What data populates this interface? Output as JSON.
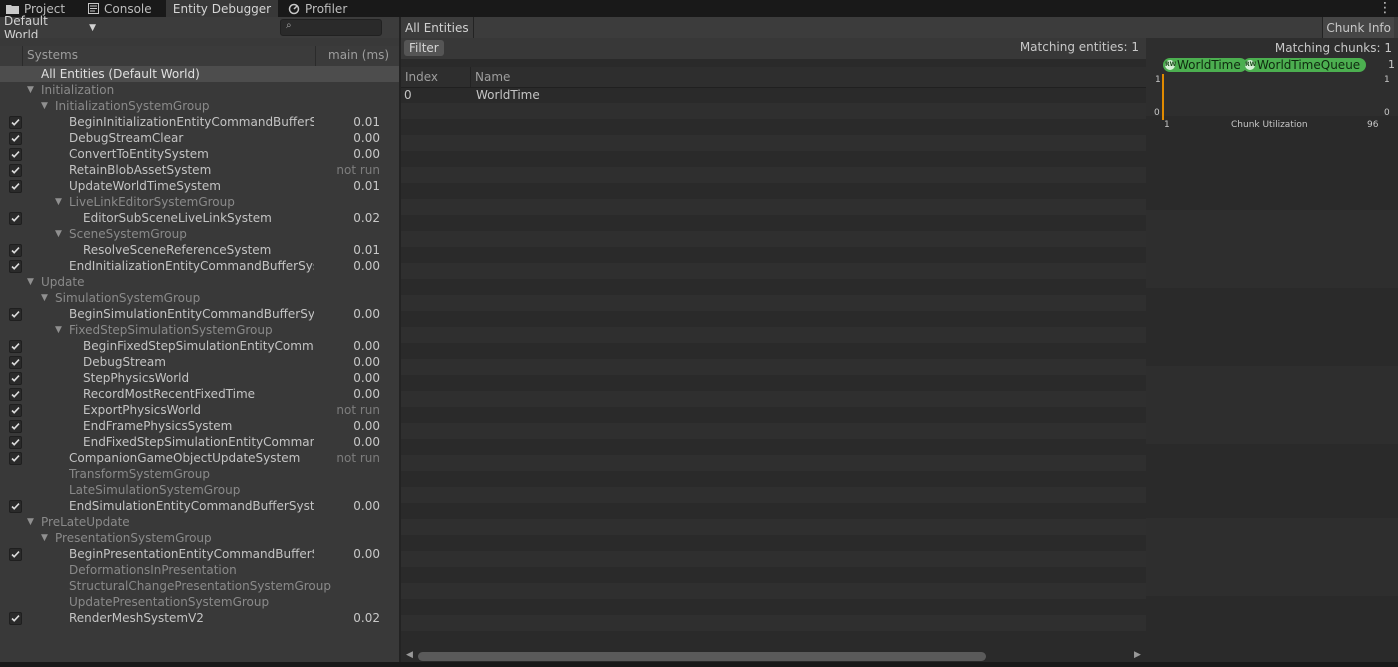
{
  "tabs": [
    {
      "label": "Project",
      "icon": "folder-icon"
    },
    {
      "label": "Console",
      "icon": "console-icon"
    },
    {
      "label": "Entity Debugger",
      "icon": ""
    },
    {
      "label": "Profiler",
      "icon": "profiler-icon"
    }
  ],
  "toolbar": {
    "world": "Default World",
    "search_placeholder": "",
    "all_entities": "All Entities",
    "chunk_info": "Chunk Info"
  },
  "systems": {
    "header": {
      "name": "Systems",
      "time": "main (ms)"
    },
    "rows": [
      {
        "label": "All Entities (Default World)",
        "selected": true
      },
      {
        "label": "Initialization",
        "group": true
      },
      {
        "label": "InitializationSystemGroup",
        "group": true
      },
      {
        "label": "BeginInitializationEntityCommandBufferSystem",
        "value": "0.01",
        "checked": true
      },
      {
        "label": "DebugStreamClear",
        "value": "0.00",
        "checked": true
      },
      {
        "label": "ConvertToEntitySystem",
        "value": "0.00",
        "checked": true
      },
      {
        "label": "RetainBlobAssetSystem",
        "value": "not run",
        "checked": true
      },
      {
        "label": "UpdateWorldTimeSystem",
        "value": "0.01",
        "checked": true
      },
      {
        "label": "LiveLinkEditorSystemGroup",
        "group": true
      },
      {
        "label": "EditorSubSceneLiveLinkSystem",
        "value": "0.02",
        "checked": true
      },
      {
        "label": "SceneSystemGroup",
        "group": true
      },
      {
        "label": "ResolveSceneReferenceSystem",
        "value": "0.01",
        "checked": true
      },
      {
        "label": "EndInitializationEntityCommandBufferSystem",
        "value": "0.00",
        "checked": true
      },
      {
        "label": "Update",
        "group": true
      },
      {
        "label": "SimulationSystemGroup",
        "group": true
      },
      {
        "label": "BeginSimulationEntityCommandBufferSystem",
        "value": "0.00",
        "checked": true
      },
      {
        "label": "FixedStepSimulationSystemGroup",
        "group": true
      },
      {
        "label": "BeginFixedStepSimulationEntityCommandBufferSystem",
        "value": "0.00",
        "checked": true
      },
      {
        "label": "DebugStream",
        "value": "0.00",
        "checked": true
      },
      {
        "label": "StepPhysicsWorld",
        "value": "0.00",
        "checked": true
      },
      {
        "label": "RecordMostRecentFixedTime",
        "value": "0.00",
        "checked": true
      },
      {
        "label": "ExportPhysicsWorld",
        "value": "not run",
        "checked": true
      },
      {
        "label": "EndFramePhysicsSystem",
        "value": "0.00",
        "checked": true
      },
      {
        "label": "EndFixedStepSimulationEntityCommandBufferSystem",
        "value": "0.00",
        "checked": true
      },
      {
        "label": "CompanionGameObjectUpdateSystem",
        "value": "not run",
        "checked": true
      },
      {
        "label": "TransformSystemGroup",
        "group": true,
        "collapsed": true
      },
      {
        "label": "LateSimulationSystemGroup",
        "group": true,
        "collapsed": true
      },
      {
        "label": "EndSimulationEntityCommandBufferSystem",
        "value": "0.00",
        "checked": true
      },
      {
        "label": "PreLateUpdate",
        "group": true
      },
      {
        "label": "PresentationSystemGroup",
        "group": true
      },
      {
        "label": "BeginPresentationEntityCommandBufferSystem",
        "value": "0.00",
        "checked": true
      },
      {
        "label": "DeformationsInPresentation",
        "group": true,
        "collapsed": true
      },
      {
        "label": "StructuralChangePresentationSystemGroup",
        "group": true,
        "collapsed": true
      },
      {
        "label": "UpdatePresentationSystemGroup",
        "group": true,
        "collapsed": true
      },
      {
        "label": "RenderMeshSystemV2",
        "value": "0.02",
        "checked": true
      }
    ]
  },
  "entities": {
    "filter": "Filter",
    "matching": "Matching entities: 1",
    "columns": {
      "index": "Index",
      "name": "Name"
    },
    "rows": [
      {
        "index": "0",
        "name": "WorldTime"
      }
    ]
  },
  "chunks": {
    "matching": "Matching chunks: 1",
    "components": [
      "WorldTime",
      "WorldTimeQueue"
    ],
    "component_badge": "RW",
    "count": "1",
    "chart": {
      "title": "Chunk Utilization",
      "y_top": "1",
      "y_bottom": "0",
      "x_left": "1",
      "x_right": "96",
      "right_top": "1",
      "right_bottom": "0"
    }
  }
}
